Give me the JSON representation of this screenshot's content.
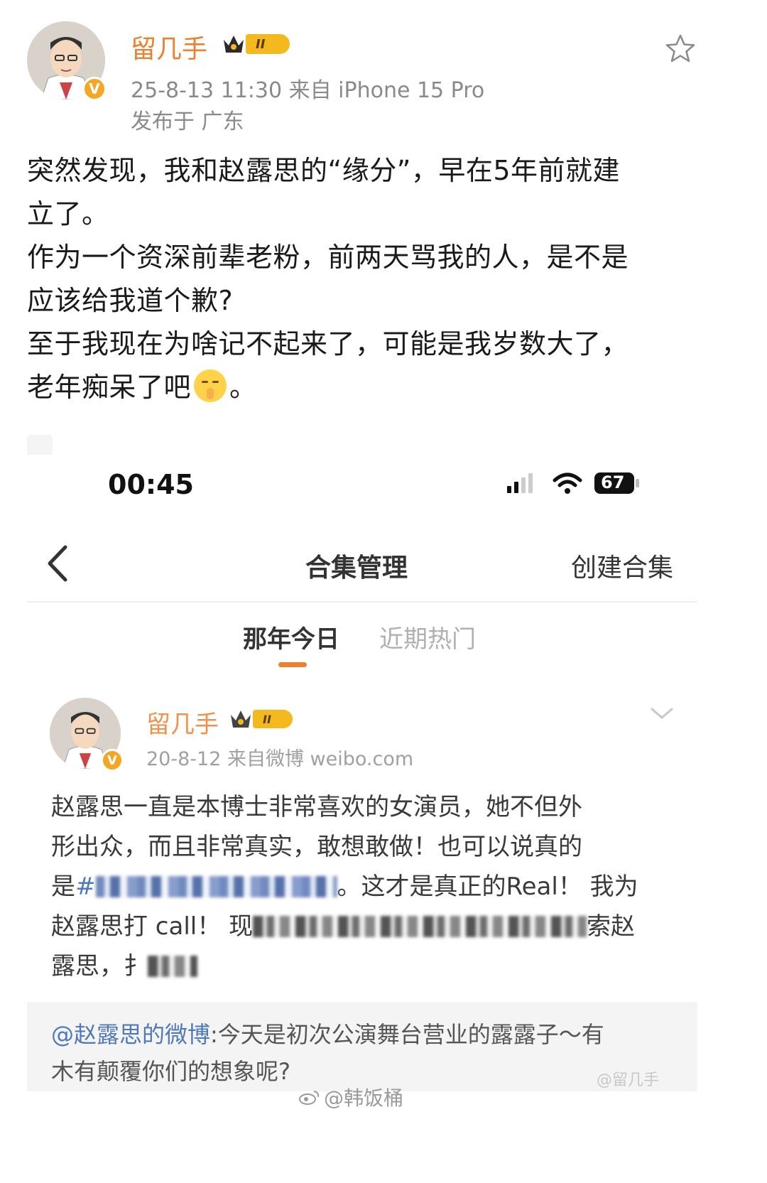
{
  "post": {
    "author": "留几手",
    "level": "II",
    "meta_line1": "25-8-13 11:30  来自 iPhone 15 Pro",
    "meta_line2": "发布于 广东",
    "body_lines": [
      "突然发现，我和赵露思的“缘分”，早在5年前就建",
      "立了。",
      "作为一个资深前辈老粉，前两天骂我的人，是不是",
      "应该给我道个歉?",
      "至于我现在为啥记不起来了，可能是我岁数大了，",
      "老年痴呆了吧"
    ],
    "body_end": "。",
    "emoji": "shush-face-icon"
  },
  "screenshot": {
    "time": "00:45",
    "battery": "67",
    "nav": {
      "title": "合集管理",
      "create": "创建合集"
    },
    "tabs": [
      {
        "label": "那年今日",
        "active": true
      },
      {
        "label": "近期热门",
        "active": false
      }
    ],
    "inner_post": {
      "author": "留几手",
      "level": "II",
      "meta": "20-8-12  来自微博  weibo.com",
      "line1": "赵露思一直是本博士非常喜欢的女演员，她不但外",
      "line2": "形出众，而且非常真实，敢想敢做！也可以说真的",
      "line3_prefix": "是",
      "line3_hash": "#",
      "line3_suffix": "。这才是真正的Real！ 我为",
      "line4_prefix": "赵露思打 call！ 现",
      "line4_suffix": "索赵",
      "line5_prefix": "露思，扌"
    },
    "repost": {
      "mention": "@赵露思的微博",
      "text1": ":今天是初次公演舞台营业的露露子～有",
      "text2": "木有颠覆你们的想象呢?"
    }
  },
  "watermarks": {
    "inner": "@留几手",
    "outer": "@韩饭桶"
  },
  "colors": {
    "brand_orange": "#ee7f2e",
    "link_blue": "#4f79b8",
    "vip_gold": "#f5b920"
  }
}
